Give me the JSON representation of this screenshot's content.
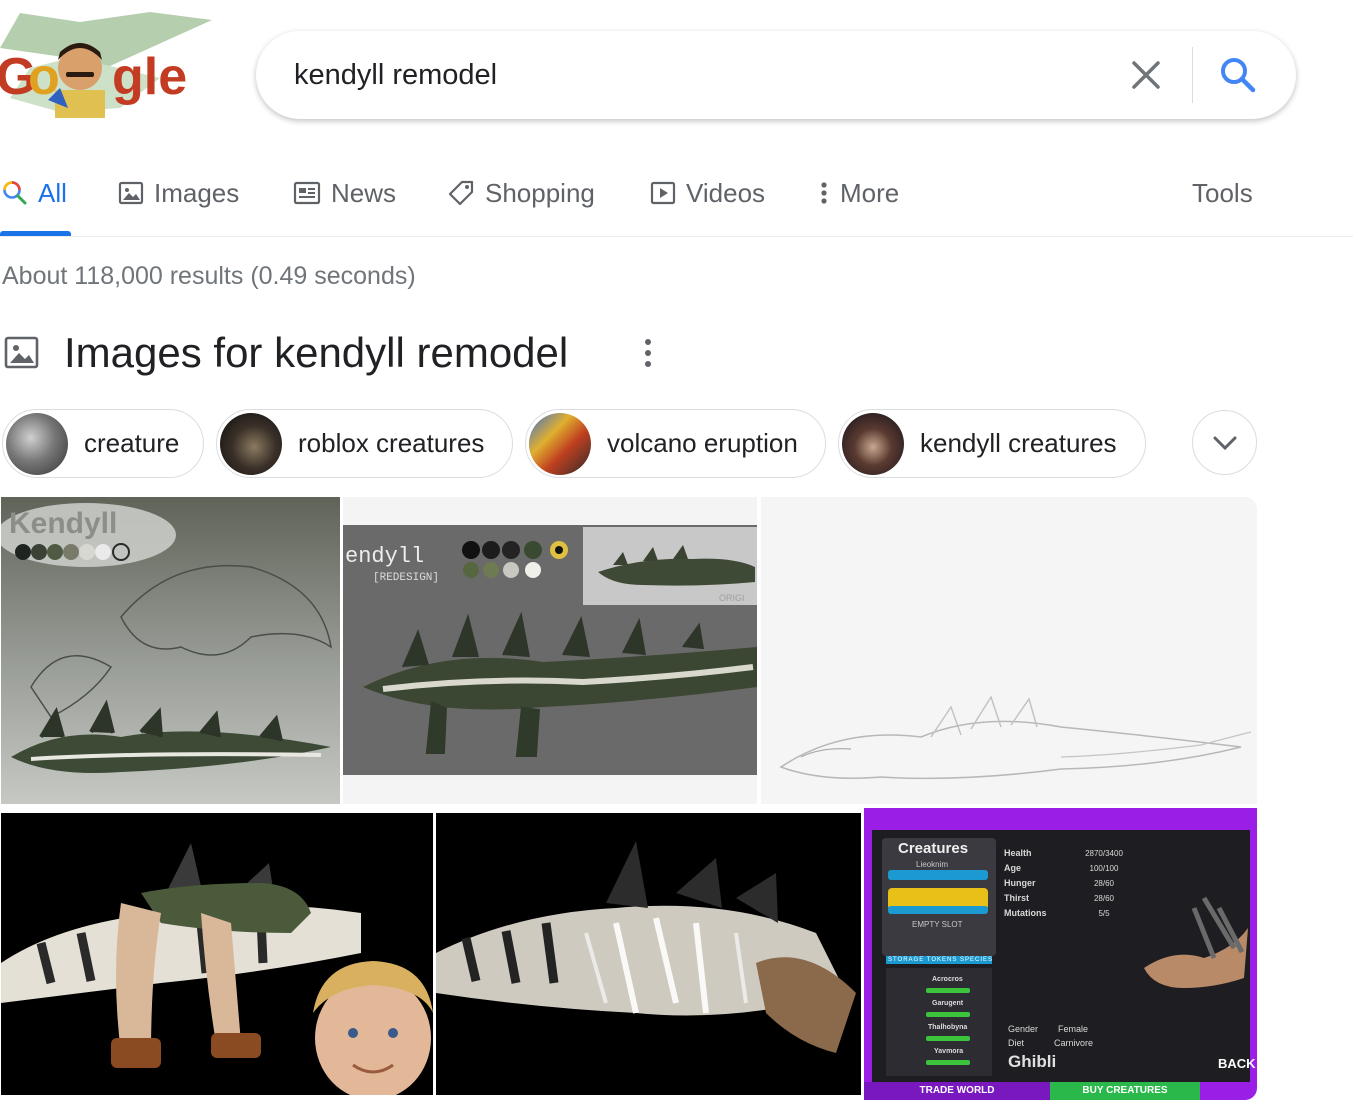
{
  "logo": {
    "text": "Google"
  },
  "search": {
    "query": "kendyll remodel"
  },
  "tabs": [
    {
      "label": "All",
      "icon": "search-icon"
    },
    {
      "label": "Images",
      "icon": "image-icon"
    },
    {
      "label": "News",
      "icon": "news-icon"
    },
    {
      "label": "Shopping",
      "icon": "tag-icon"
    },
    {
      "label": "Videos",
      "icon": "play-icon"
    },
    {
      "label": "More",
      "icon": "dots-vertical-icon"
    }
  ],
  "tools_label": "Tools",
  "result_stats": "About 118,000 results (0.49 seconds)",
  "images_section": {
    "title": "Images for kendyll remodel"
  },
  "chips": [
    {
      "label": "creature"
    },
    {
      "label": "roblox creatures"
    },
    {
      "label": "volcano eruption"
    },
    {
      "label": "kendyll creatures"
    }
  ],
  "image_texts": {
    "img1_title": "Kendyll",
    "img2_title": "endyll",
    "img2_subtitle": "[REDESIGN]",
    "img2_small": "ORIGI",
    "img6": {
      "panel_title": "Creatures",
      "slot1_name": "Lieoknim",
      "slot_empty": "EMPTY SLOT",
      "stats_labels": [
        "Health",
        "Age",
        "Hunger",
        "Thirst",
        "Mutations"
      ],
      "stats_values": [
        "2870/3400",
        "100/100",
        "28/60",
        "28/60",
        "5/5"
      ],
      "tabs_row": [
        "STORAGE",
        "TOKENS",
        "SPECIES"
      ],
      "list_names": [
        "Acrocros",
        "Garugent",
        "Thalhobyna",
        "Yavmora"
      ],
      "gender_label": "Gender",
      "gender_value": "Female",
      "diet_label": "Diet",
      "diet_value": "Carnivore",
      "creature_name": "Ghibli",
      "back_label": "BACK",
      "trade_label": "TRADE WORLD",
      "buy_label": "BUY CREATURES"
    }
  },
  "colors": {
    "accent": "#1a73e8",
    "text_secondary": "#5f6368",
    "stats": "#70757a",
    "magenta": "#9b1ee6"
  }
}
